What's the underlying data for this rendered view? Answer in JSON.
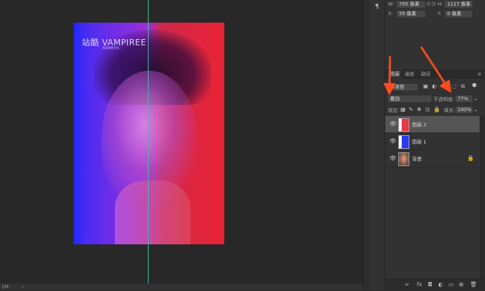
{
  "canvas": {
    "doc_title": "站酷 VAMPIREE",
    "doc_subtitle": "采用调色方法"
  },
  "status_bar": {
    "zoom": "1M",
    "arrow": "›"
  },
  "dock": {
    "paragraph_icon": "paragraph-icon",
    "paragraph_glyph": "¶"
  },
  "properties": {
    "w_label": "W:",
    "w_value": "705 像素",
    "h_label": "H:",
    "h_value": "1117 像素",
    "x_label": "X:",
    "x_value": "55 像素",
    "y_label": "Y:",
    "y_value": "0 像素",
    "link_glyph": "⊂⊃"
  },
  "layers_panel": {
    "tabs": [
      "图层",
      "通道",
      "路径"
    ],
    "active_tab": 0,
    "menu_glyph": "≡",
    "filter_kind": "Ｏ类型",
    "blend_mode": "叠加",
    "opacity_label": "不透明度:",
    "opacity_value": "77%",
    "lock_label": "锁定:",
    "fill_label": "填充:",
    "fill_value": "100%",
    "layers": [
      {
        "name": "图层 2",
        "selected": true,
        "thumb_color": "#e33a44"
      },
      {
        "name": "图层 1",
        "selected": false,
        "thumb_color": "#2c3aee"
      },
      {
        "name": "背景",
        "selected": false,
        "thumb_color": "#c98f7a",
        "locked": true
      }
    ],
    "bottom_icons": [
      "∞",
      "fx",
      "◘",
      "◐",
      "▭",
      "⊞",
      "🗑"
    ]
  },
  "colors": {
    "accent_arrow": "#ff4a1c",
    "guide": "#3fbfa6"
  }
}
